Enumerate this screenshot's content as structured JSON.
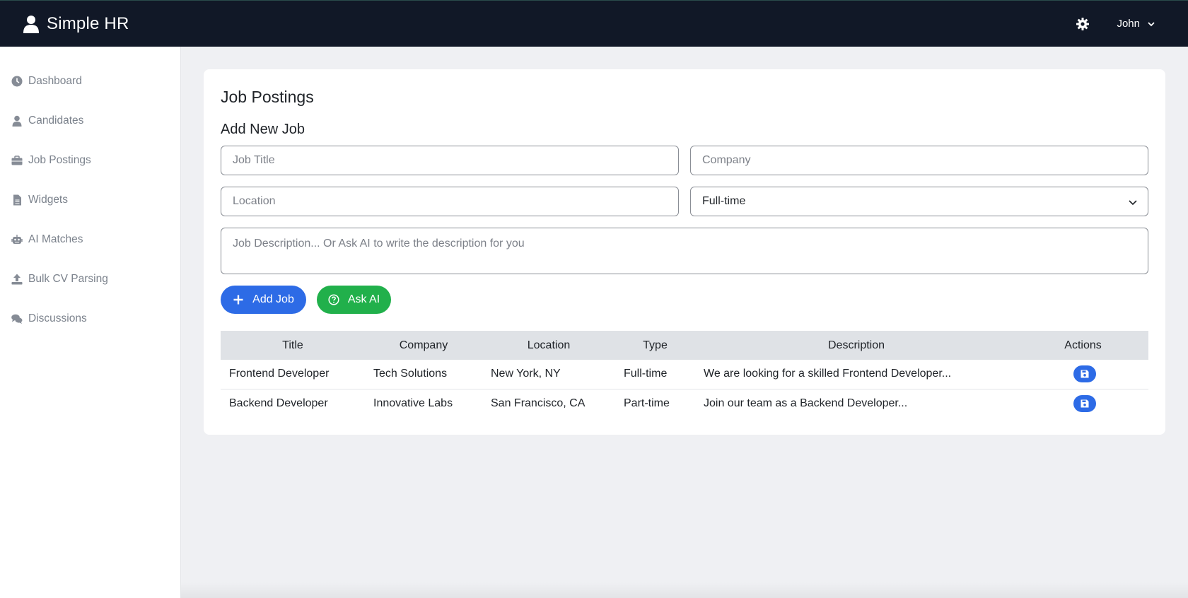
{
  "app": {
    "brand": "Simple HR",
    "user_name": "John"
  },
  "sidebar": {
    "items": [
      {
        "label": "Dashboard",
        "icon": "clock-icon"
      },
      {
        "label": "Candidates",
        "icon": "user-icon"
      },
      {
        "label": "Job Postings",
        "icon": "briefcase-icon"
      },
      {
        "label": "Widgets",
        "icon": "file-icon"
      },
      {
        "label": "AI Matches",
        "icon": "robot-icon"
      },
      {
        "label": "Bulk CV Parsing",
        "icon": "upload-icon"
      },
      {
        "label": "Discussions",
        "icon": "comments-icon"
      }
    ]
  },
  "page": {
    "title": "Job Postings",
    "section_title": "Add New Job"
  },
  "form": {
    "job_title_placeholder": "Job Title",
    "company_placeholder": "Company",
    "location_placeholder": "Location",
    "type_selected": "Full-time",
    "description_placeholder": "Job Description... Or Ask AI to write the description for you",
    "add_button": "Add Job",
    "ask_ai_button": "Ask AI"
  },
  "table": {
    "headers": [
      "Title",
      "Company",
      "Location",
      "Type",
      "Description",
      "Actions"
    ],
    "rows": [
      {
        "title": "Frontend Developer",
        "company": "Tech Solutions",
        "location": "New York, NY",
        "type": "Full-time",
        "description": "We are looking for a skilled Frontend Developer..."
      },
      {
        "title": "Backend Developer",
        "company": "Innovative Labs",
        "location": "San Francisco, CA",
        "type": "Part-time",
        "description": "Join our team as a Backend Developer..."
      }
    ]
  },
  "colors": {
    "topbar": "#111827",
    "primary": "#2d6be6",
    "success": "#21b04b"
  }
}
